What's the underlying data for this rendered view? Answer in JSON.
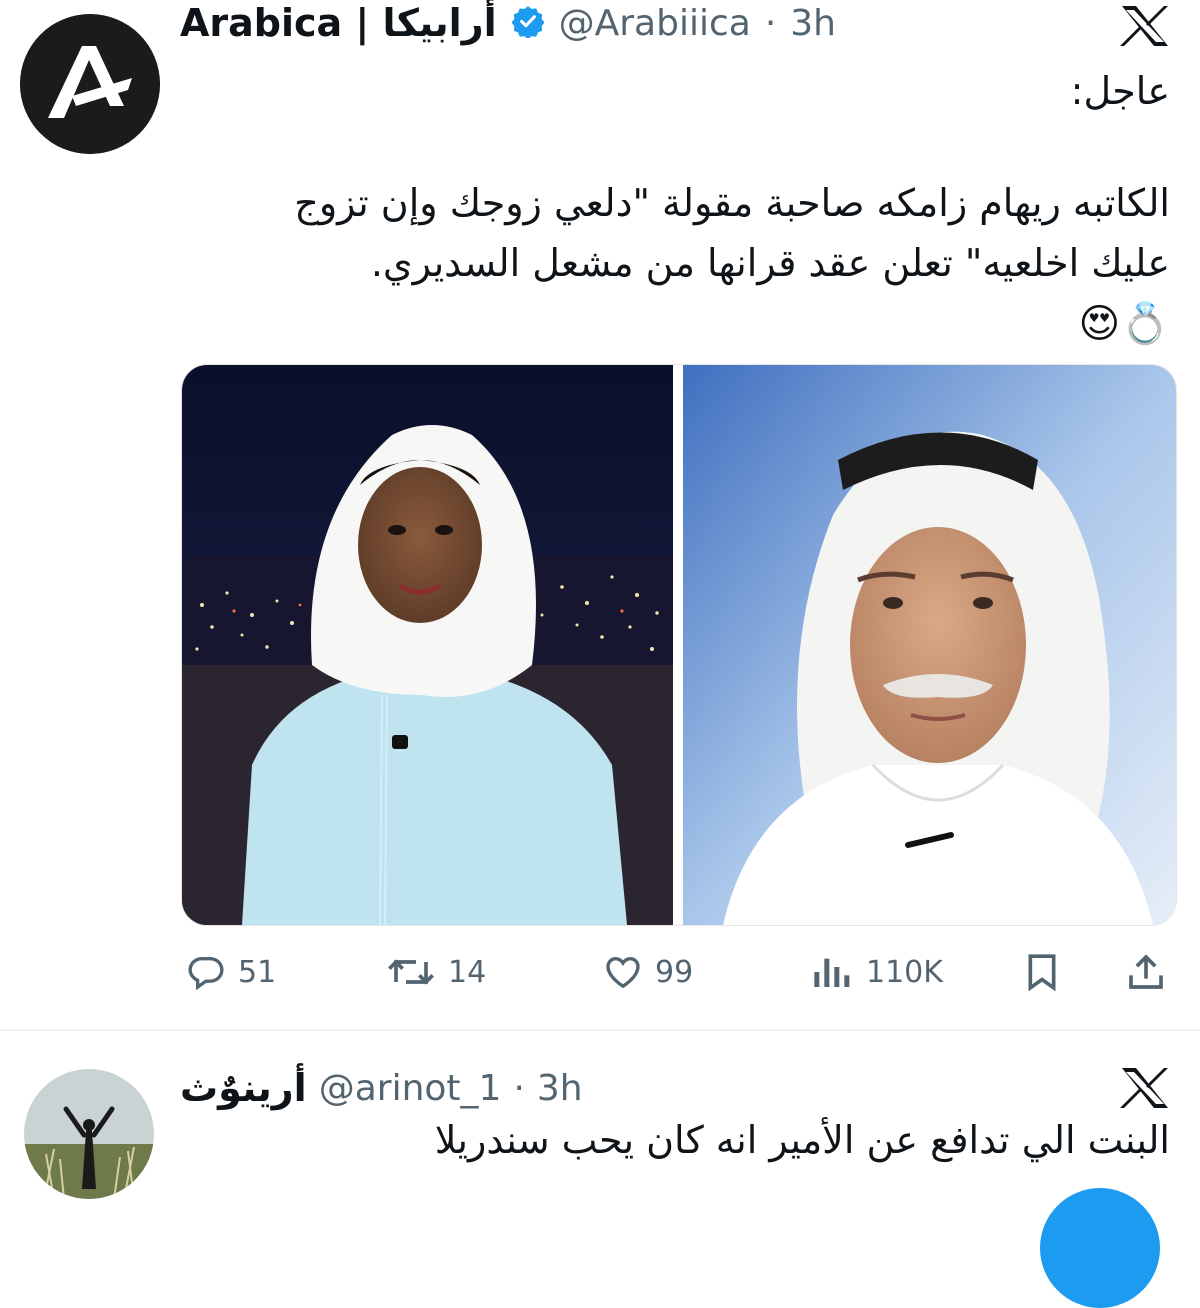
{
  "tweet": {
    "author": {
      "display_name": "Arabica | أرابيكا",
      "handle": "@Arabiiica",
      "time": "3h"
    },
    "text_lines": [
      "عاجل:",
      "الكاتبه ريهام زامكه صاحبة مقولة \"دلعي زوجك وإن تزوج",
      "عليك اخلعيه\" تعلن عقد قرانها من مشعل السديري.",
      "💍😍"
    ],
    "stats": {
      "replies": "51",
      "reposts": "14",
      "likes": "99",
      "views": "110K"
    },
    "icons": [
      "verified-badge-icon",
      "x-logo-icon",
      "reply-icon",
      "repost-icon",
      "like-icon",
      "views-icon",
      "bookmark-icon",
      "share-icon"
    ],
    "colors": {
      "accent": "#1d9bf0",
      "muted": "#536471",
      "text": "#0f1419"
    }
  },
  "reply_tweet": {
    "author": {
      "display_name": "أرينوٌث",
      "handle": "@arinot_1",
      "time": "3h"
    },
    "text": "البنت الي تدافع عن الأمير انه كان يحب سندريلا"
  }
}
